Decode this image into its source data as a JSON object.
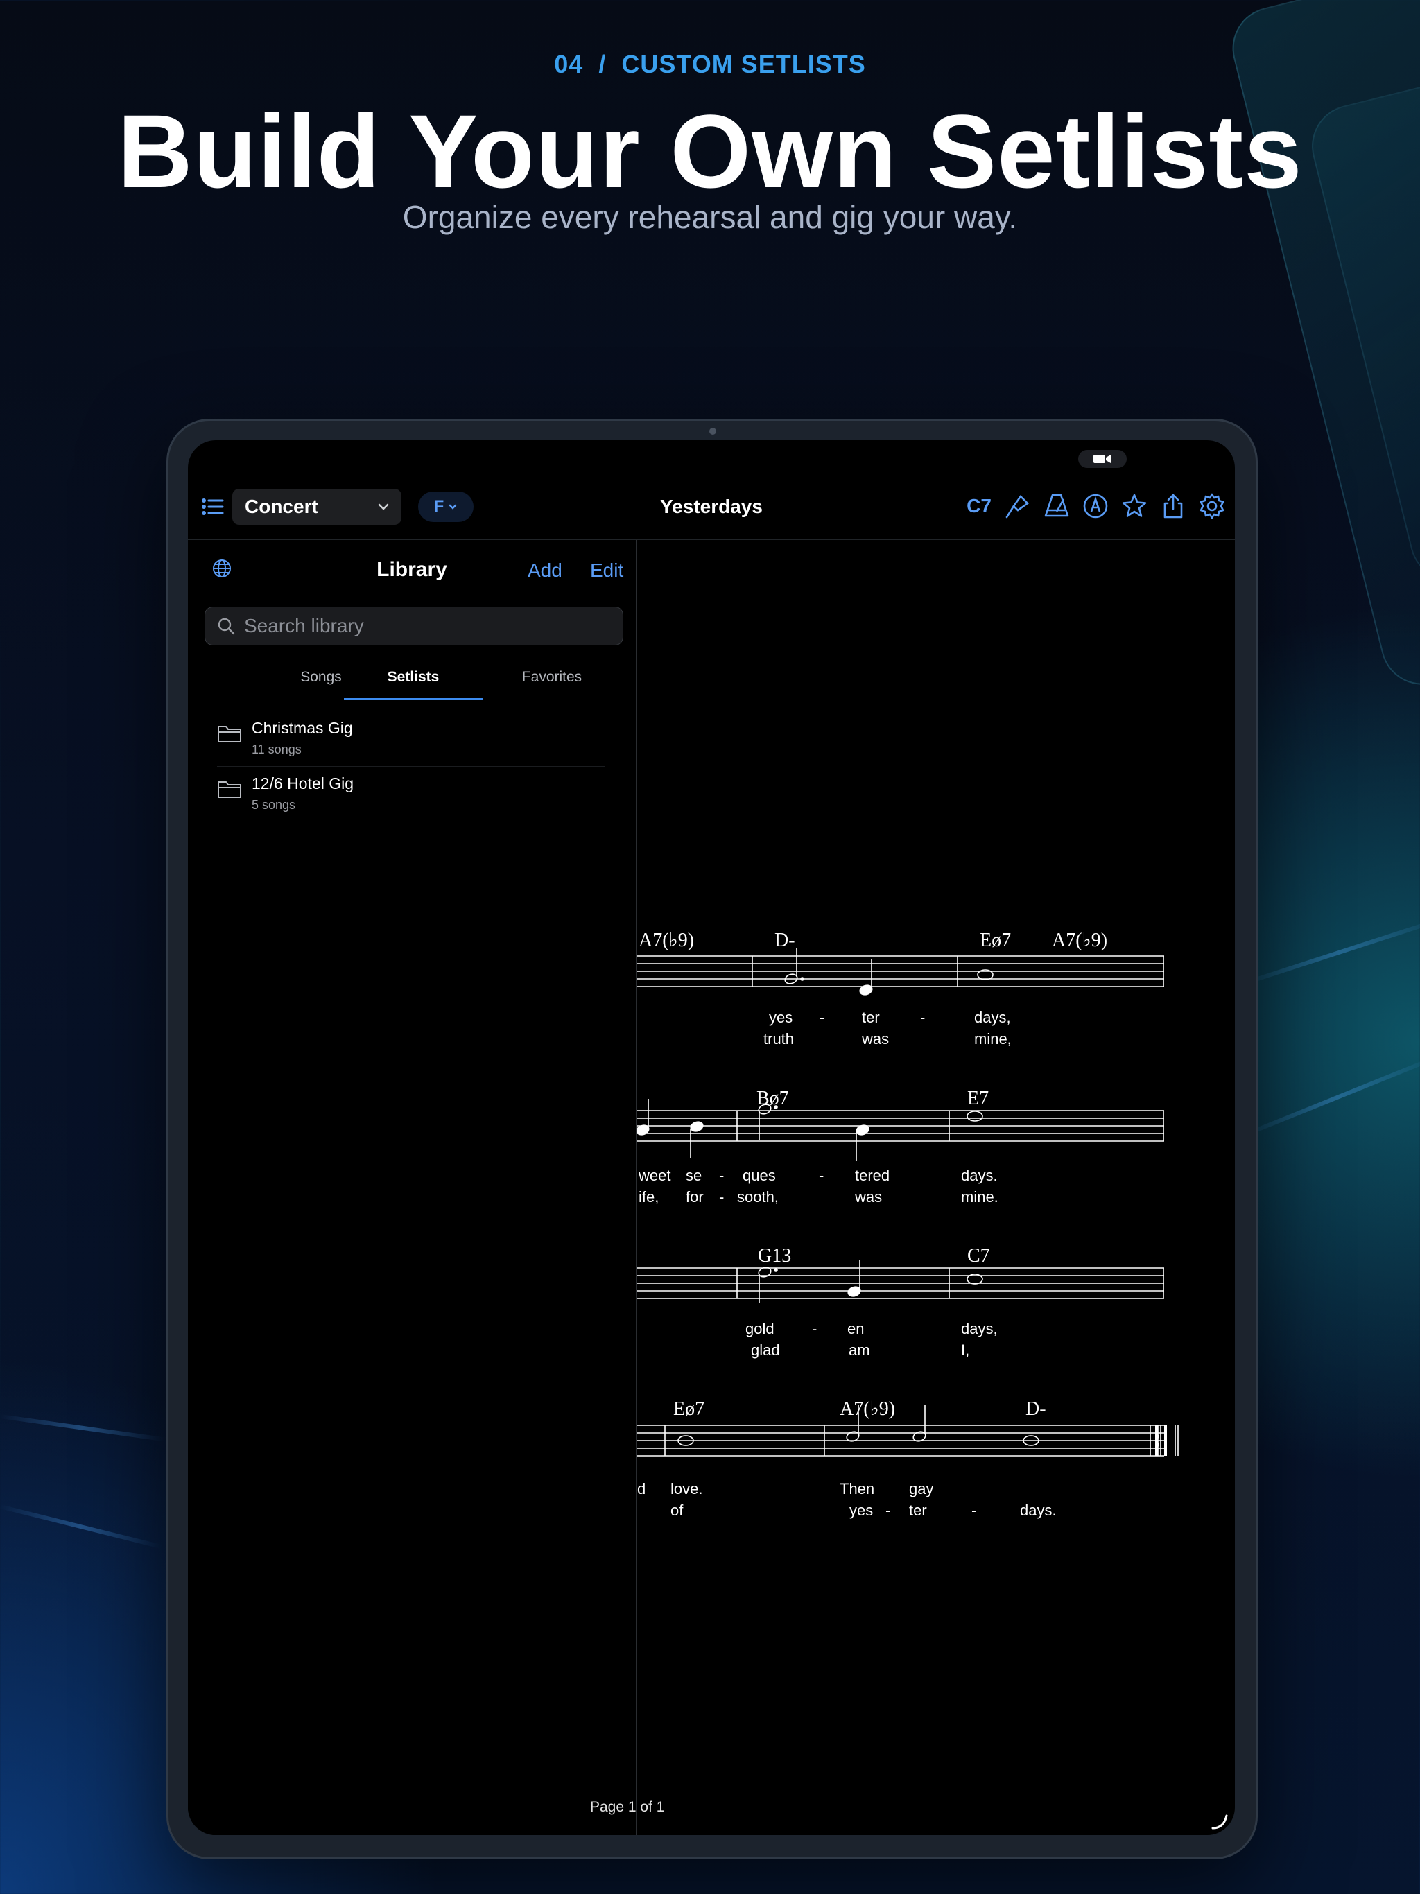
{
  "marketing": {
    "section_number": "04",
    "separator": "/",
    "section_label": "CUSTOM SETLISTS",
    "headline": "Build Your Own Setlists",
    "subheadline": "Organize every rehearsal and gig your way."
  },
  "toolbar": {
    "menu_icon": "list-icon",
    "instrument": "Concert",
    "key": "F",
    "song_title": "Yesterdays",
    "transpose_label": "C7",
    "icons": [
      "mic-icon",
      "metronome-icon",
      "pen-icon",
      "star-icon",
      "share-icon",
      "gear-icon"
    ]
  },
  "library": {
    "globe_icon": "globe-icon",
    "title": "Library",
    "add_label": "Add",
    "edit_label": "Edit",
    "search_placeholder": "Search library",
    "tabs": [
      {
        "label": "Songs",
        "active": false
      },
      {
        "label": "Setlists",
        "active": true
      },
      {
        "label": "Favorites",
        "active": false
      }
    ],
    "setlists": [
      {
        "name": "Christmas Gig",
        "count": "11 songs"
      },
      {
        "name": "12/6 Hotel Gig",
        "count": "5 songs"
      }
    ]
  },
  "sheet": {
    "systems": [
      {
        "chords": [
          "A7(♭9)",
          "D-",
          "Eø7",
          "A7(♭9)"
        ],
        "lyrics1": [
          "yes",
          "-",
          "ter",
          "-",
          "days,"
        ],
        "lyrics2": [
          "truth",
          "was",
          "mine,"
        ]
      },
      {
        "chords": [
          "Bø7",
          "E7"
        ],
        "lyrics1": [
          "weet",
          "se",
          "-",
          "ques",
          "-",
          "tered",
          "days."
        ],
        "lyrics2": [
          "ife,",
          "for",
          "-",
          "sooth,",
          "was",
          "mine."
        ]
      },
      {
        "chords": [
          "G13",
          "C7"
        ],
        "lyrics1": [
          "gold",
          "-",
          "en",
          "days,"
        ],
        "lyrics2": [
          "glad",
          "am",
          "I,"
        ]
      },
      {
        "chords": [
          "Eø7",
          "A7(♭9)",
          "D-"
        ],
        "lyrics1": [
          "d",
          "love.",
          "Then",
          "gay"
        ],
        "lyrics2": [
          "of",
          "yes",
          "-",
          "ter",
          "-",
          "days."
        ]
      }
    ],
    "page_indicator": "Page 1 of 1"
  },
  "colors": {
    "accent": "#5a9cf5",
    "eyebrow": "#3aa0ee",
    "background": "#000000"
  }
}
